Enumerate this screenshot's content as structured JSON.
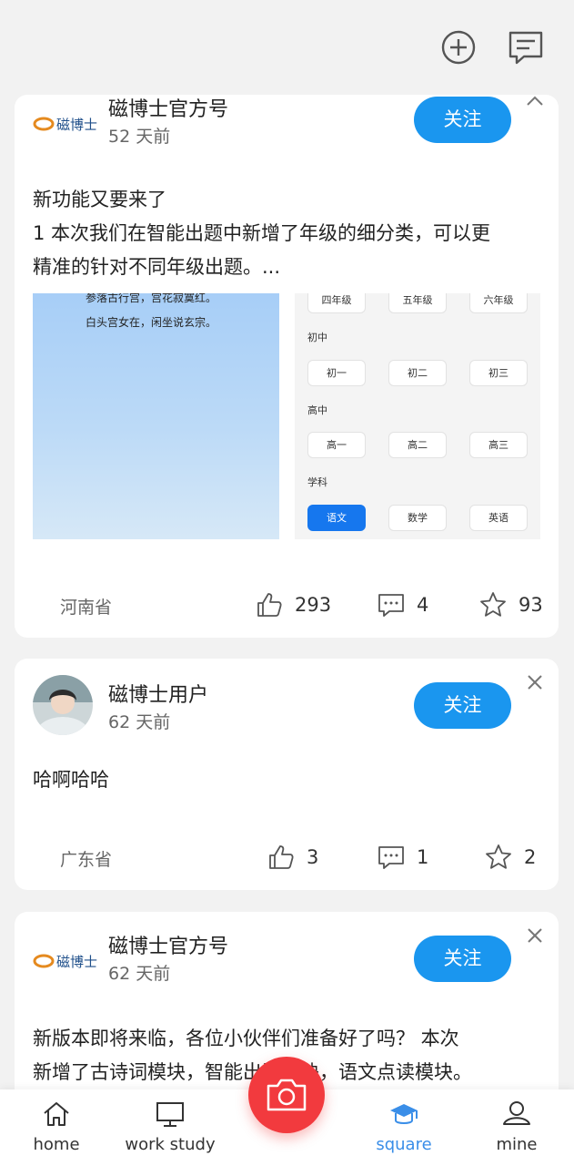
{
  "colors": {
    "accent": "#1a96ef",
    "active_tab": "#3a8ee8",
    "camera": "#f23a3e"
  },
  "top_icons": [
    "add-circle-icon",
    "message-icon"
  ],
  "posts": [
    {
      "author": "磁博士官方号",
      "time": "52 天前",
      "follow_label": "关注",
      "logo_text": "磁博士",
      "text_lines": [
        "新功能又要来了",
        "1 本次我们在智能出题中新增了年级的细分类，可以更",
        "精准的针对不同年级出题。..."
      ],
      "poem_lines": [
        "参落古行宫，宫花寂寞红。",
        "白头宫女在，闲坐说玄宗。"
      ],
      "grade_panel": {
        "rows": [
          {
            "items": [
              "四年级",
              "五年级",
              "六年级"
            ]
          },
          {
            "heading": "初中",
            "items": [
              "初一",
              "初二",
              "初三"
            ]
          },
          {
            "heading": "高中",
            "items": [
              "高一",
              "高二",
              "高三"
            ]
          },
          {
            "heading": "学科",
            "items": [
              "语文",
              "数学",
              "英语"
            ],
            "selected": "语文"
          }
        ]
      },
      "location": "河南省",
      "likes": "293",
      "comments": "4",
      "favorites": "93"
    },
    {
      "author": "磁博士用户",
      "time": "62 天前",
      "follow_label": "关注",
      "text_lines": [
        "哈啊哈哈"
      ],
      "location": "广东省",
      "likes": "3",
      "comments": "1",
      "favorites": "2"
    },
    {
      "author": "磁博士官方号",
      "time": "62 天前",
      "follow_label": "关注",
      "logo_text": "磁博士",
      "text_lines": [
        "新版本即将来临，各位小伙伴们准备好了吗？  本次",
        "新增了古诗词模块，智能出题模块，语文点读模块。"
      ]
    }
  ],
  "tabbar": {
    "items": [
      {
        "label": "home",
        "icon": "home-icon"
      },
      {
        "label": "work study",
        "icon": "monitor-icon"
      },
      {
        "label": "square",
        "icon": "graduation-cap-icon",
        "active": true
      },
      {
        "label": "mine",
        "icon": "user-icon"
      }
    ],
    "center_icon": "camera-icon"
  }
}
